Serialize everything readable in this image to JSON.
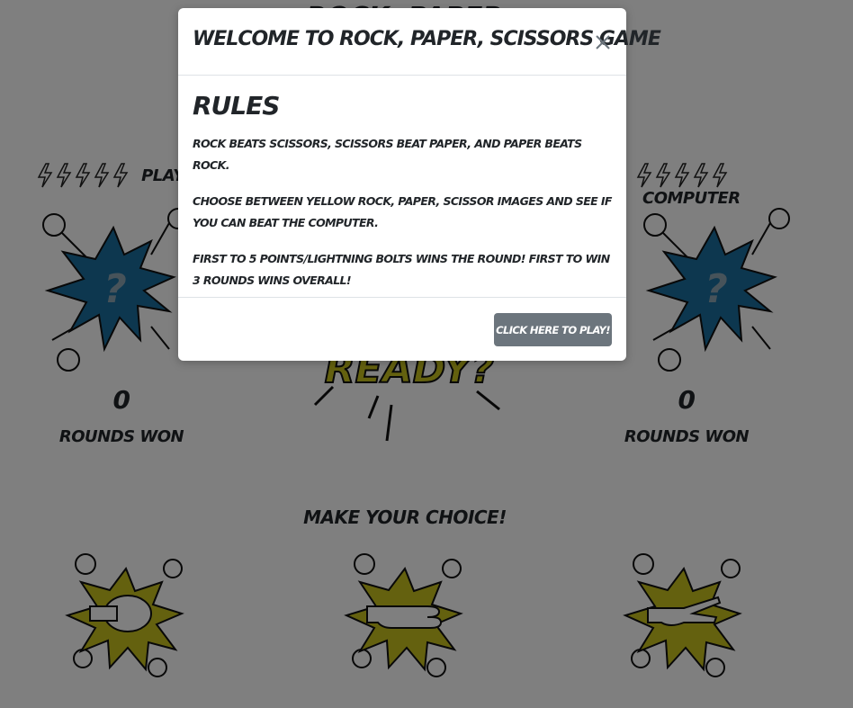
{
  "game": {
    "title": "ROCK, PAPER, SCISSORS",
    "player_label": "Player",
    "computer_label": "Computer",
    "player_score": "0",
    "computer_score": "0",
    "rounds_won_label": "Rounds Won",
    "unknown_choice": "?",
    "ready_text": "READY?",
    "choice_heading": "Make your choice!",
    "choices": [
      "rock",
      "paper",
      "scissors"
    ],
    "bolt_count": 5
  },
  "modal": {
    "title": "Welcome to Rock, Paper, Scissors Game",
    "rules_heading": "Rules",
    "rules": [
      "Rock beats scissors, scissors beat paper, and paper beats rock.",
      "Choose between yellow rock, paper, scissor images and see if you can beat the computer.",
      "First to 5 points/lightning bolts wins the round! First to win 3 rounds wins overall!"
    ],
    "play_button": "Click here to play!",
    "close_icon": "close-icon"
  },
  "colors": {
    "burst_blue": "#1a6f9e",
    "burst_yellow": "#c9c21e",
    "backdrop": "rgba(0,0,0,0.5)",
    "button_gray": "#6c757d"
  }
}
